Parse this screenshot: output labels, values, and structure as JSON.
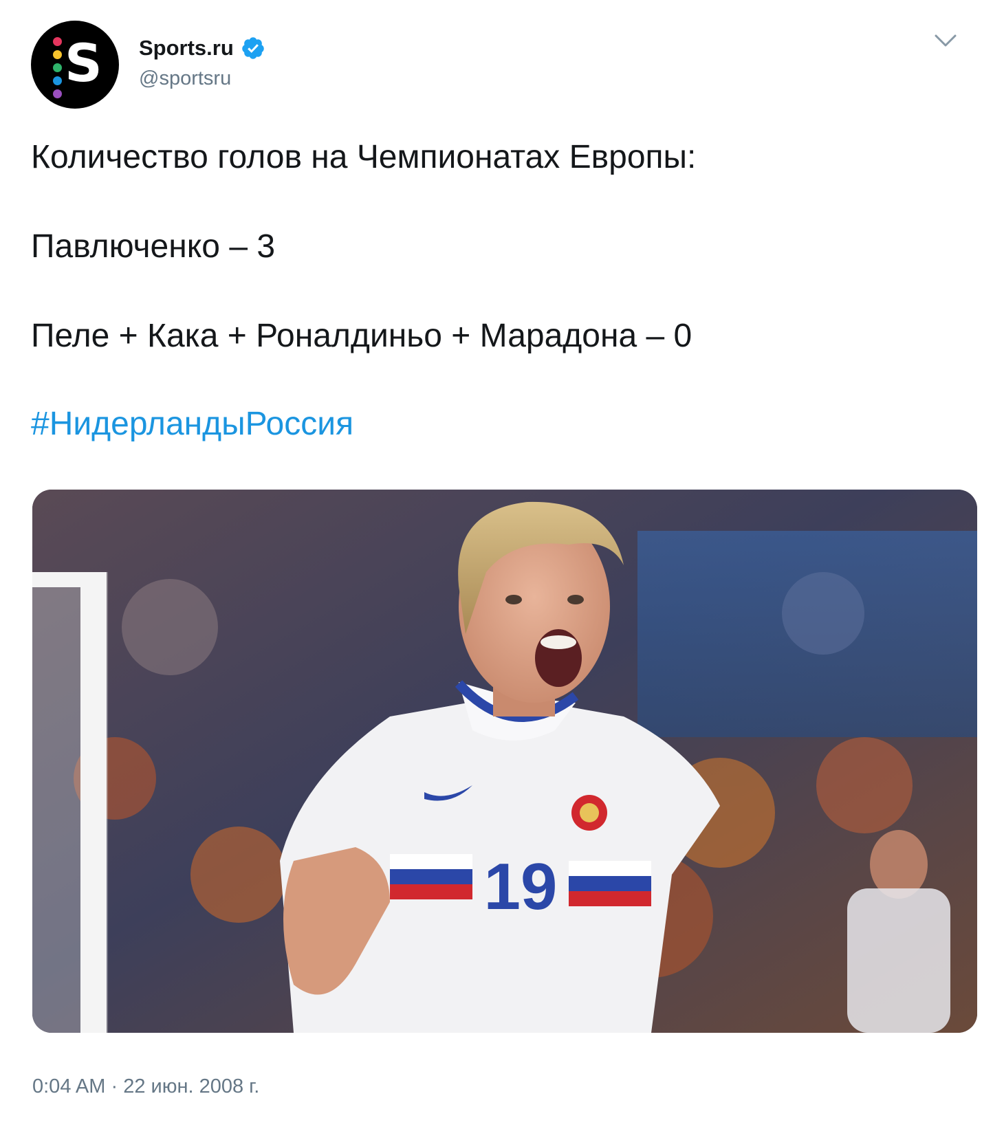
{
  "account": {
    "display_name": "Sports.ru",
    "handle": "@sportsru",
    "avatar_letter": "S",
    "avatar_dot_colors": [
      "#e5365f",
      "#f7c32d",
      "#2fb36b",
      "#1b95e0",
      "#9a4fbf"
    ]
  },
  "tweet": {
    "line1": "Количество голов на Чемпионатах Европы:",
    "line2": "Павлюченко – 3",
    "line3": "Пеле + Кака + Роналдиньо + Марадона – 0",
    "hashtag": "#НидерландыРоссия"
  },
  "photo": {
    "jersey_number": "19"
  },
  "meta": {
    "time": "0:04 AM",
    "separator": "·",
    "date": "22 июн. 2008 г."
  },
  "colors": {
    "link": "#1b95e0",
    "secondary_text": "#657786",
    "verified": "#1da1f2"
  },
  "icons": {
    "verified": "verified-badge-icon",
    "menu": "chevron-down-icon"
  }
}
